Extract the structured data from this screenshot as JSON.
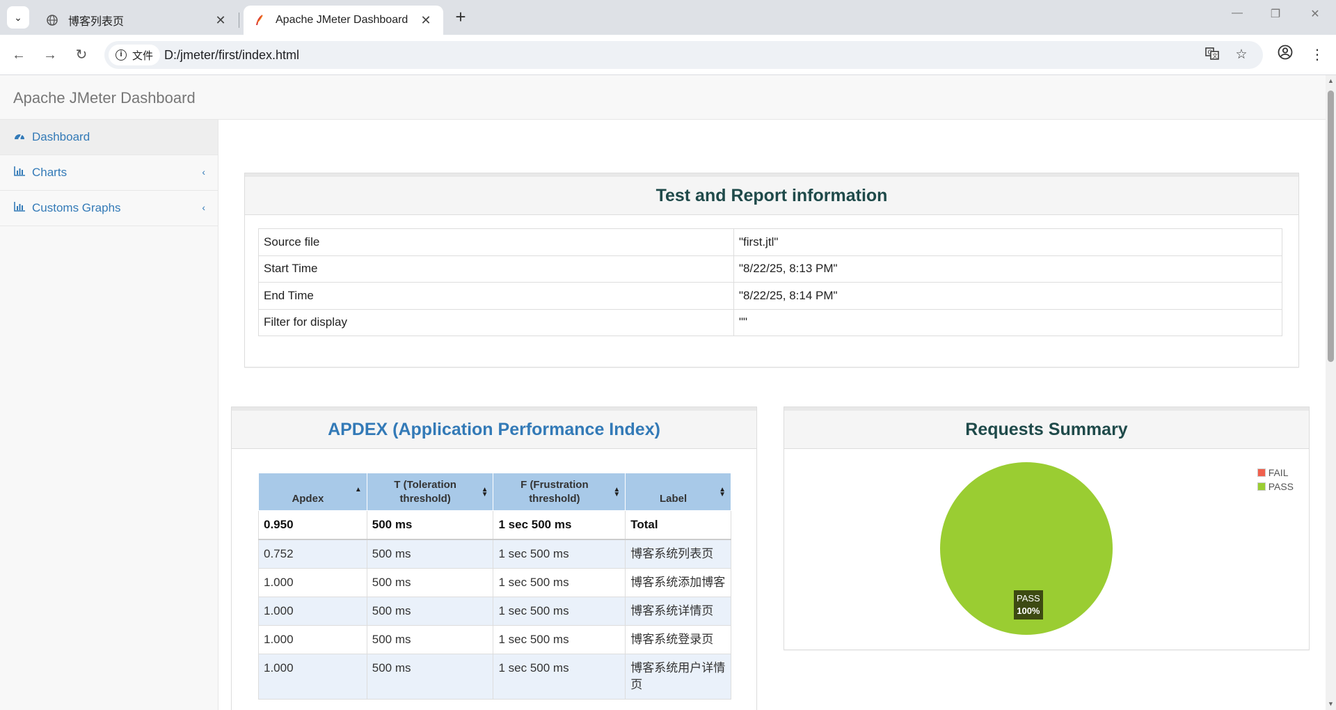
{
  "browser": {
    "tabs": [
      {
        "title": "博客列表页",
        "active": false
      },
      {
        "title": "Apache JMeter Dashboard",
        "active": true
      }
    ],
    "site_chip": "文件",
    "url": "D:/jmeter/first/index.html"
  },
  "app": {
    "brand": "Apache JMeter Dashboard"
  },
  "sidebar": {
    "items": [
      {
        "label": "Dashboard",
        "icon": "dashboard-icon"
      },
      {
        "label": "Charts",
        "icon": "bar-chart-icon"
      },
      {
        "label": "Customs Graphs",
        "icon": "bar-chart-icon"
      }
    ]
  },
  "info": {
    "title": "Test and Report information",
    "rows": [
      {
        "key": "Source file",
        "value": "\"first.jtl\""
      },
      {
        "key": "Start Time",
        "value": "\"8/22/25, 8:13 PM\""
      },
      {
        "key": "End Time",
        "value": "\"8/22/25, 8:14 PM\""
      },
      {
        "key": "Filter for display",
        "value": "\"\""
      }
    ]
  },
  "apdex": {
    "title": "APDEX (Application Performance Index)",
    "headers": [
      "Apdex",
      "T (Toleration threshold)",
      "F (Frustration threshold)",
      "Label"
    ],
    "total": {
      "apdex": "0.950",
      "t": "500 ms",
      "f": "1 sec 500 ms",
      "label": "Total"
    },
    "rows": [
      {
        "apdex": "0.752",
        "t": "500 ms",
        "f": "1 sec 500 ms",
        "label": "博客系统列表页"
      },
      {
        "apdex": "1.000",
        "t": "500 ms",
        "f": "1 sec 500 ms",
        "label": "博客系统添加博客"
      },
      {
        "apdex": "1.000",
        "t": "500 ms",
        "f": "1 sec 500 ms",
        "label": "博客系统详情页"
      },
      {
        "apdex": "1.000",
        "t": "500 ms",
        "f": "1 sec 500 ms",
        "label": "博客系统登录页"
      },
      {
        "apdex": "1.000",
        "t": "500 ms",
        "f": "1 sec 500 ms",
        "label": "博客系统用户详情页"
      }
    ]
  },
  "requests": {
    "title": "Requests Summary",
    "legend": [
      {
        "label": "FAIL",
        "color": "#f0604d"
      },
      {
        "label": "PASS",
        "color": "#9acd32"
      }
    ],
    "slice_label": "PASS",
    "slice_pct": "100%"
  },
  "chart_data": {
    "type": "pie",
    "title": "",
    "categories": [
      "FAIL",
      "PASS"
    ],
    "values": [
      0,
      100
    ],
    "colors": [
      "#f0604d",
      "#9acd32"
    ],
    "legend": "top-right"
  }
}
